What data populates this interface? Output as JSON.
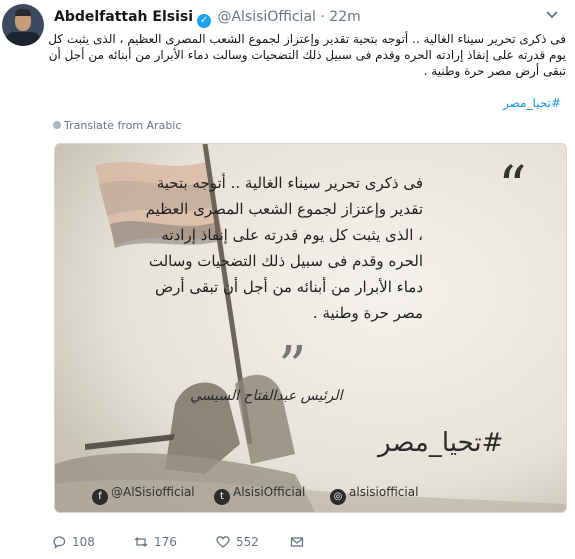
{
  "author": {
    "name": "Abdelfattah Elsisi",
    "handle": "@AlsisiOfficial",
    "separator": "·",
    "time": "22m"
  },
  "tweet": {
    "text": "فى ذكرى تحرير سيناء الغالية .. أتوجه بتحية تقدير وإعتزاز لجموع الشعب المصرى العظيم ، الذى يثبت كل يوم قدرته على إنفاذ إرادته الحره وقدم فى سبيل ذلك التضحيات وسالت دماء الأبرار من أبنائه من أجل أن تبقى أرض مصر حرة وطنية .",
    "hashtag": "#تحيا_مصر",
    "translate_label": "Translate from Arabic"
  },
  "card": {
    "quote": "فى ذكرى تحرير سيناء الغالية .. أتوجه بتحية تقدير وإعتزاز لجموع الشعب المصرى العظيم ، الذى يثبت كل يوم قدرته على إنفاذ إرادته الحره وقدم فى سبيل ذلك التضحيات وسالت دماء الأبرار من أبنائه من أجل أن تبقى أرض مصر حرة وطنية .",
    "signature": "الرئيس عبدالفتاح السيسي",
    "hashtag": "#تحيا_مصر",
    "facebook": "@AlSisiofficial",
    "twitter": "AlsisiOfficial",
    "instagram": "alsisiofficial"
  },
  "actions": {
    "replies": "108",
    "retweets": "176",
    "likes": "552"
  },
  "colors": {
    "link": "#1b95e0",
    "muted": "#657786",
    "verified": "#1da1f2"
  }
}
